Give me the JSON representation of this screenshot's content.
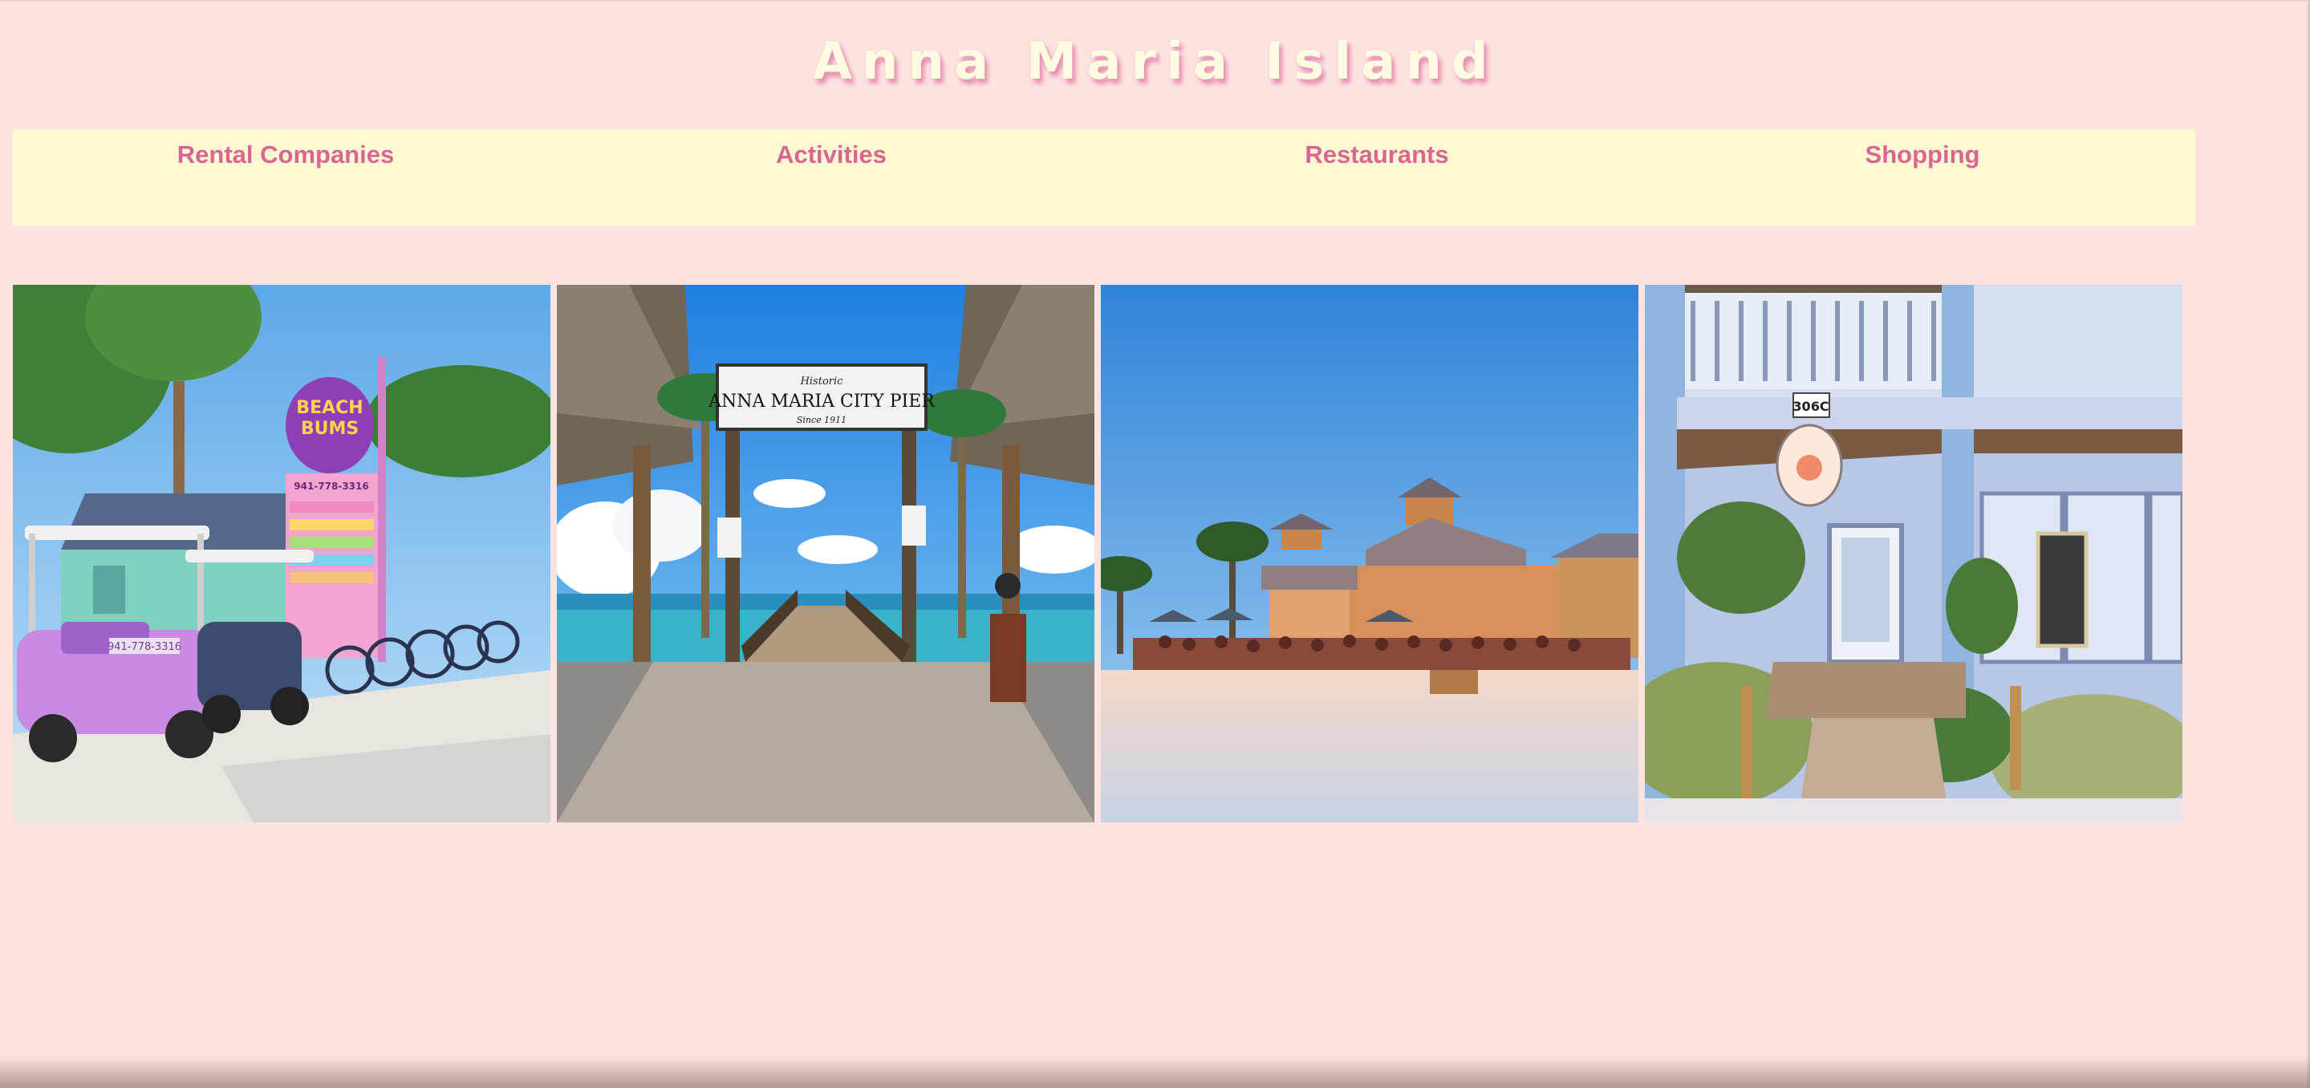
{
  "site": {
    "title": "Anna Maria Island"
  },
  "nav": {
    "items": [
      {
        "label": "Rental Companies"
      },
      {
        "label": "Activities"
      },
      {
        "label": "Restaurants"
      },
      {
        "label": "Shopping"
      }
    ]
  },
  "gallery": {
    "photos": [
      {
        "subject": "beach-bums-rentals-photo",
        "sign_lines": [
          "BEACH",
          "BUMS",
          "941-778-3316"
        ],
        "cart_plate": "941-778-3316"
      },
      {
        "subject": "city-pier-photo",
        "sign_small": "Historic",
        "sign_main": "ANNA MARIA CITY PIER",
        "sign_since": "Since 1911"
      },
      {
        "subject": "beachfront-restaurant-photo"
      },
      {
        "subject": "shop-storefront-photo",
        "address": "306C"
      }
    ]
  },
  "colors": {
    "background": "#fde3e0",
    "title": "#fffbe0",
    "title_shadow": "#e58fb1",
    "nav_background": "#fff9d3",
    "nav_text": "#d86592"
  }
}
